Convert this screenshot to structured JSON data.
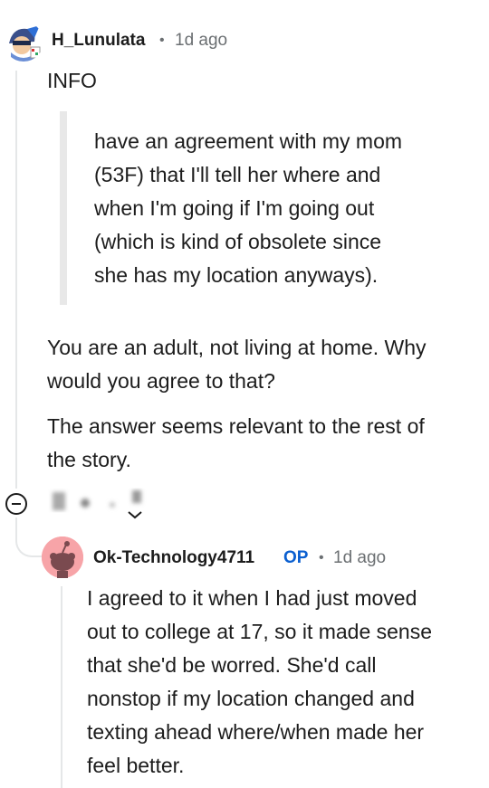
{
  "comment1": {
    "username": "H_Lunulata",
    "age": "1d ago",
    "heading": "INFO",
    "quote_lines": [
      "have an agreement with my mom",
      "(53F) that I'll tell her where and",
      "when I'm going if I'm going out",
      "(which is kind of obsolete since",
      "she has my location anyways)."
    ],
    "paragraph1_lines": [
      "You are an adult, not living at home. Why",
      "would you agree to that?"
    ],
    "paragraph2_lines": [
      "The answer seems relevant to the rest of",
      "the story."
    ]
  },
  "comment2": {
    "username": "Ok-Technology4711",
    "op_badge": "OP",
    "age": "1d ago",
    "body_lines": [
      "I agreed to it when I had just moved",
      "out to college at 17, so it made sense",
      "that she'd be worred. She'd call",
      "nonstop if my location changed and",
      "texting ahead where/when made her",
      "feel better."
    ]
  },
  "icons": {
    "collapse": "collapse-thread-icon",
    "avatar1": "gnome-avatar-icon",
    "avatar2": "snoo-avatar-icon"
  },
  "colors": {
    "op": "#0a5fd0",
    "avatar2_bg": "#f7a4a8",
    "meta": "#6b6f72"
  }
}
